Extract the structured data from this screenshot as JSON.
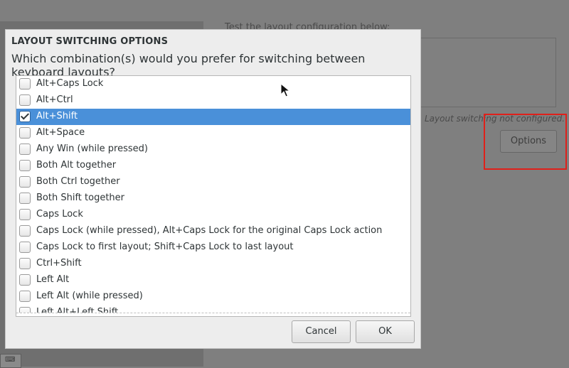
{
  "background": {
    "test_label": "Test the layout configuration below:",
    "status_text": "Layout switching not configured.",
    "options_button": "Options",
    "keyboard_icon": "⌨"
  },
  "dialog": {
    "title": "LAYOUT SWITCHING OPTIONS",
    "question": "Which combination(s) would you prefer for switching between keyboard layouts?",
    "options": [
      {
        "label": "Alt+Caps Lock",
        "checked": false,
        "selected": false
      },
      {
        "label": "Alt+Ctrl",
        "checked": false,
        "selected": false
      },
      {
        "label": "Alt+Shift",
        "checked": true,
        "selected": true
      },
      {
        "label": "Alt+Space",
        "checked": false,
        "selected": false
      },
      {
        "label": "Any Win (while pressed)",
        "checked": false,
        "selected": false
      },
      {
        "label": "Both Alt together",
        "checked": false,
        "selected": false
      },
      {
        "label": "Both Ctrl together",
        "checked": false,
        "selected": false
      },
      {
        "label": "Both Shift together",
        "checked": false,
        "selected": false
      },
      {
        "label": "Caps Lock",
        "checked": false,
        "selected": false
      },
      {
        "label": "Caps Lock (while pressed), Alt+Caps Lock for the original Caps Lock action",
        "checked": false,
        "selected": false
      },
      {
        "label": "Caps Lock to first layout; Shift+Caps Lock to last layout",
        "checked": false,
        "selected": false
      },
      {
        "label": "Ctrl+Shift",
        "checked": false,
        "selected": false
      },
      {
        "label": "Left Alt",
        "checked": false,
        "selected": false
      },
      {
        "label": "Left Alt (while pressed)",
        "checked": false,
        "selected": false
      },
      {
        "label": "Left Alt+Left Shift",
        "checked": false,
        "selected": false
      }
    ],
    "cancel_label": "Cancel",
    "ok_label": "OK"
  },
  "colors": {
    "selection": "#4a90d9",
    "highlight_box": "#e0201a"
  }
}
